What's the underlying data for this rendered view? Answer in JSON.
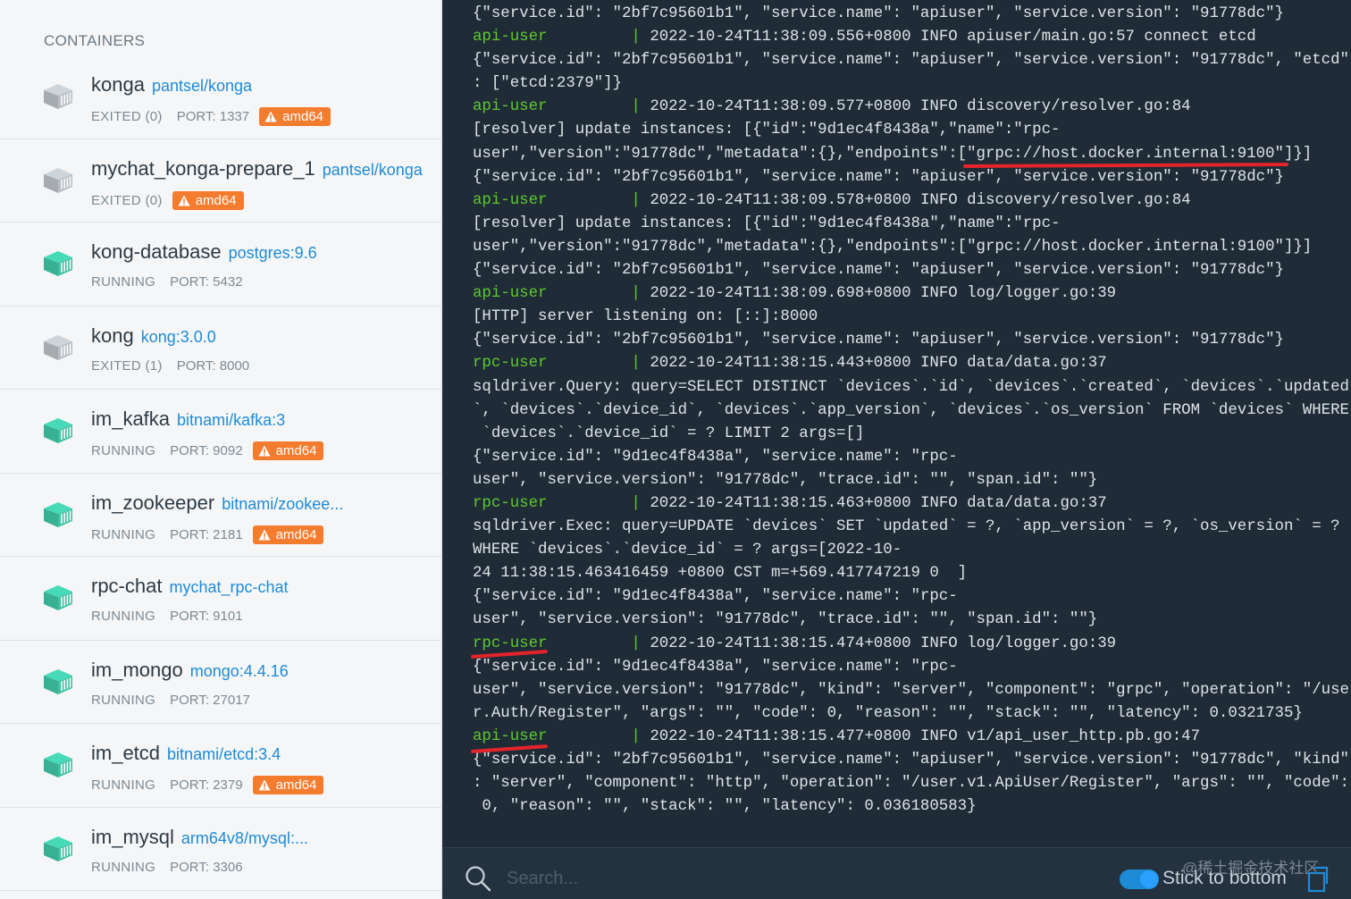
{
  "sidebar": {
    "title": "CONTAINERS",
    "containers": [
      {
        "name": "konga",
        "image": "pantsel/konga",
        "state": "EXITED (0)",
        "port": "PORT: 1337",
        "arch": "amd64",
        "running": false
      },
      {
        "name": "mychat_konga-prepare_1",
        "image": "pantsel/konga",
        "state": "EXITED (0)",
        "port": "",
        "arch": "amd64",
        "running": false
      },
      {
        "name": "kong-database",
        "image": "postgres:9.6",
        "state": "RUNNING",
        "port": "PORT: 5432",
        "arch": "",
        "running": true
      },
      {
        "name": "kong",
        "image": "kong:3.0.0",
        "state": "EXITED (1)",
        "port": "PORT: 8000",
        "arch": "",
        "running": false
      },
      {
        "name": "im_kafka",
        "image": "bitnami/kafka:3",
        "state": "RUNNING",
        "port": "PORT: 9092",
        "arch": "amd64",
        "running": true
      },
      {
        "name": "im_zookeeper",
        "image": "bitnami/zookee...",
        "state": "RUNNING",
        "port": "PORT: 2181",
        "arch": "amd64",
        "running": true
      },
      {
        "name": "rpc-chat",
        "image": "mychat_rpc-chat",
        "state": "RUNNING",
        "port": "PORT: 9101",
        "arch": "",
        "running": true
      },
      {
        "name": "im_mongo",
        "image": "mongo:4.4.16",
        "state": "RUNNING",
        "port": "PORT: 27017",
        "arch": "",
        "running": true
      },
      {
        "name": "im_etcd",
        "image": "bitnami/etcd:3.4",
        "state": "RUNNING",
        "port": "PORT: 2379",
        "arch": "amd64",
        "running": true
      },
      {
        "name": "im_mysql",
        "image": "arm64v8/mysql:...",
        "state": "RUNNING",
        "port": "PORT: 3306",
        "arch": "",
        "running": true
      }
    ]
  },
  "colors": {
    "running_icon": "#3fc3a4",
    "exited_icon": "#b8bec3",
    "arch_badge": "#f47c2f",
    "log_service": "#5fc92e",
    "annotation_underline": "#e3242b"
  },
  "log": {
    "lines": [
      {
        "text": "{\"service.id\": \"2bf7c95601b1\", \"service.name\": \"apiuser\", \"service.version\": \"91778dc\"}"
      },
      {
        "service": "api-user",
        "text": "2022-10-24T11:38:09.556+0800 INFO apiuser/main.go:57 connect etcd"
      },
      {
        "text": "{\"service.id\": \"2bf7c95601b1\", \"service.name\": \"apiuser\", \"service.version\": \"91778dc\", \"etcd\""
      },
      {
        "text": ": [\"etcd:2379\"]}"
      },
      {
        "service": "api-user",
        "text": "2022-10-24T11:38:09.577+0800 INFO discovery/resolver.go:84"
      },
      {
        "text": "[resolver] update instances: [{\"id\":\"9d1ec4f8438a\",\"name\":\"rpc-"
      },
      {
        "text": "user\",\"version\":\"91778dc\",\"metadata\":{},\"endpoints\":[\"grpc://host.docker.internal:9100\"]}]"
      },
      {
        "text": "{\"service.id\": \"2bf7c95601b1\", \"service.name\": \"apiuser\", \"service.version\": \"91778dc\"}"
      },
      {
        "service": "api-user",
        "text": "2022-10-24T11:38:09.578+0800 INFO discovery/resolver.go:84"
      },
      {
        "text": "[resolver] update instances: [{\"id\":\"9d1ec4f8438a\",\"name\":\"rpc-"
      },
      {
        "text": "user\",\"version\":\"91778dc\",\"metadata\":{},\"endpoints\":[\"grpc://host.docker.internal:9100\"]}]"
      },
      {
        "text": "{\"service.id\": \"2bf7c95601b1\", \"service.name\": \"apiuser\", \"service.version\": \"91778dc\"}"
      },
      {
        "service": "api-user",
        "text": "2022-10-24T11:38:09.698+0800 INFO log/logger.go:39"
      },
      {
        "text": "[HTTP] server listening on: [::]:8000"
      },
      {
        "text": "{\"service.id\": \"2bf7c95601b1\", \"service.name\": \"apiuser\", \"service.version\": \"91778dc\"}"
      },
      {
        "service": "rpc-user",
        "text": "2022-10-24T11:38:15.443+0800 INFO data/data.go:37"
      },
      {
        "text": "sqldriver.Query: query=SELECT DISTINCT `devices`.`id`, `devices`.`created`, `devices`.`updated"
      },
      {
        "text": "`, `devices`.`device_id`, `devices`.`app_version`, `devices`.`os_version` FROM `devices` WHERE"
      },
      {
        "text": " `devices`.`device_id` = ? LIMIT 2 args=[]"
      },
      {
        "text": "{\"service.id\": \"9d1ec4f8438a\", \"service.name\": \"rpc-"
      },
      {
        "text": "user\", \"service.version\": \"91778dc\", \"trace.id\": \"\", \"span.id\": \"\"}"
      },
      {
        "service": "rpc-user",
        "text": "2022-10-24T11:38:15.463+0800 INFO data/data.go:37"
      },
      {
        "text": "sqldriver.Exec: query=UPDATE `devices` SET `updated` = ?, `app_version` = ?, `os_version` = ?"
      },
      {
        "text": "WHERE `devices`.`device_id` = ? args=[2022-10-"
      },
      {
        "text": "24 11:38:15.463416459 +0800 CST m=+569.417747219 0  ]"
      },
      {
        "text": "{\"service.id\": \"9d1ec4f8438a\", \"service.name\": \"rpc-"
      },
      {
        "text": "user\", \"service.version\": \"91778dc\", \"trace.id\": \"\", \"span.id\": \"\"}"
      },
      {
        "service": "rpc-user",
        "text": "2022-10-24T11:38:15.474+0800 INFO log/logger.go:39"
      },
      {
        "text": "{\"service.id\": \"9d1ec4f8438a\", \"service.name\": \"rpc-"
      },
      {
        "text": "user\", \"service.version\": \"91778dc\", \"kind\": \"server\", \"component\": \"grpc\", \"operation\": \"/use"
      },
      {
        "text": "r.Auth/Register\", \"args\": \"\", \"code\": 0, \"reason\": \"\", \"stack\": \"\", \"latency\": 0.0321735}"
      },
      {
        "service": "api-user",
        "text": "2022-10-24T11:38:15.477+0800 INFO v1/api_user_http.pb.go:47"
      },
      {
        "text": "{\"service.id\": \"2bf7c95601b1\", \"service.name\": \"apiuser\", \"service.version\": \"91778dc\", \"kind\""
      },
      {
        "text": ": \"server\", \"component\": \"http\", \"operation\": \"/user.v1.ApiUser/Register\", \"args\": \"\", \"code\":"
      },
      {
        "text": " 0, \"reason\": \"\", \"stack\": \"\", \"latency\": 0.036180583}"
      }
    ]
  },
  "bottom_bar": {
    "search_placeholder": "Search...",
    "stick_to_bottom_label": "Stick to bottom",
    "stick_to_bottom_on": true,
    "watermark": "@稀土掘金技术社区"
  }
}
